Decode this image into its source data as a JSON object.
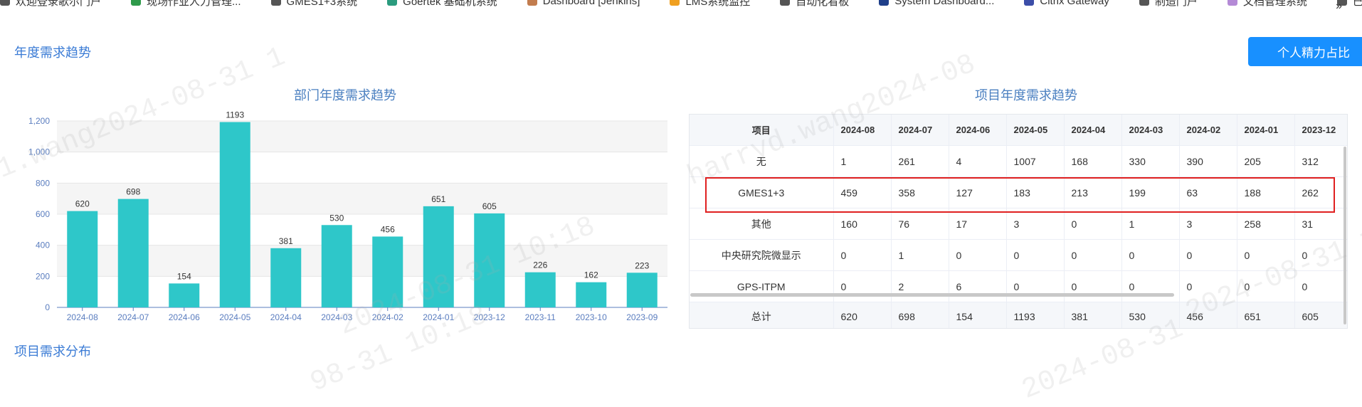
{
  "bookmarks": [
    {
      "label": "欢迎登录歌尔门户",
      "icon": "loop-icon",
      "color": "#555"
    },
    {
      "label": "现场作业人力管理...",
      "icon": "leaf-icon",
      "color": "#2e9a4a"
    },
    {
      "label": "GMES1+3系统",
      "icon": "loop-icon",
      "color": "#555"
    },
    {
      "label": "Goertek 基础机系统",
      "icon": "layers-icon",
      "color": "#2b9b7e"
    },
    {
      "label": "Dashboard [Jenkins]",
      "icon": "jenkins-icon",
      "color": "#c27c4e"
    },
    {
      "label": "LMS系统监控",
      "icon": "gear-icon",
      "color": "#f0a020"
    },
    {
      "label": "自动化看板",
      "icon": "loop-icon",
      "color": "#555"
    },
    {
      "label": "System Dashboard...",
      "icon": "x-icon",
      "color": "#1f3f8a"
    },
    {
      "label": "Citrix Gateway",
      "icon": "citrix-icon",
      "color": "#3c4ea8"
    },
    {
      "label": "制造门户",
      "icon": "loop-icon",
      "color": "#555"
    },
    {
      "label": "文档管理系统",
      "icon": "doc-icon",
      "color": "#b48ad6"
    },
    {
      "label": "已导入",
      "icon": "folder-icon",
      "color": "#555"
    }
  ],
  "bookmarks_overflow": "»",
  "section_title": "年度需求趋势",
  "personal_button": "个人精力占比",
  "left_chart_title": "部门年度需求趋势",
  "right_table_title": "项目年度需求趋势",
  "bottom_section_title": "项目需求分布",
  "chart_data": {
    "type": "bar",
    "title": "部门年度需求趋势",
    "categories": [
      "2024-08",
      "2024-07",
      "2024-06",
      "2024-05",
      "2024-04",
      "2024-03",
      "2024-02",
      "2024-01",
      "2023-12",
      "2023-11",
      "2023-10",
      "2023-09"
    ],
    "values": [
      620,
      698,
      154,
      1193,
      381,
      530,
      456,
      651,
      605,
      226,
      162,
      223
    ],
    "y_ticks": [
      "0",
      "200",
      "400",
      "600",
      "800",
      "1,000",
      "1,200"
    ],
    "ylim": [
      0,
      1200
    ],
    "grid": true,
    "bar_color": "#2ec7c9",
    "axis_color": "#5a7dbf"
  },
  "table": {
    "headers": [
      "项目",
      "2024-08",
      "2024-07",
      "2024-06",
      "2024-05",
      "2024-04",
      "2024-03",
      "2024-02",
      "2024-01",
      "2023-12"
    ],
    "rows": [
      [
        "无",
        "1",
        "261",
        "4",
        "1007",
        "168",
        "330",
        "390",
        "205",
        "312"
      ],
      [
        "GMES1+3",
        "459",
        "358",
        "127",
        "183",
        "213",
        "199",
        "63",
        "188",
        "262"
      ],
      [
        "其他",
        "160",
        "76",
        "17",
        "3",
        "0",
        "1",
        "3",
        "258",
        "31"
      ],
      [
        "中央研究院微显示",
        "0",
        "1",
        "0",
        "0",
        "0",
        "0",
        "0",
        "0",
        "0"
      ],
      [
        "GPS-ITPM",
        "0",
        "2",
        "6",
        "0",
        "0",
        "0",
        "0",
        "0",
        "0"
      ]
    ],
    "total": [
      "总计",
      "620",
      "698",
      "154",
      "1193",
      "381",
      "530",
      "456",
      "651",
      "605"
    ]
  },
  "watermarks": [
    "1.wang2024-08-31 1",
    "harryd.wang2024-08",
    "2024-08-31 10:18",
    "2024-08-31 10:18",
    "98-31 10:18",
    "2024-08-31"
  ]
}
